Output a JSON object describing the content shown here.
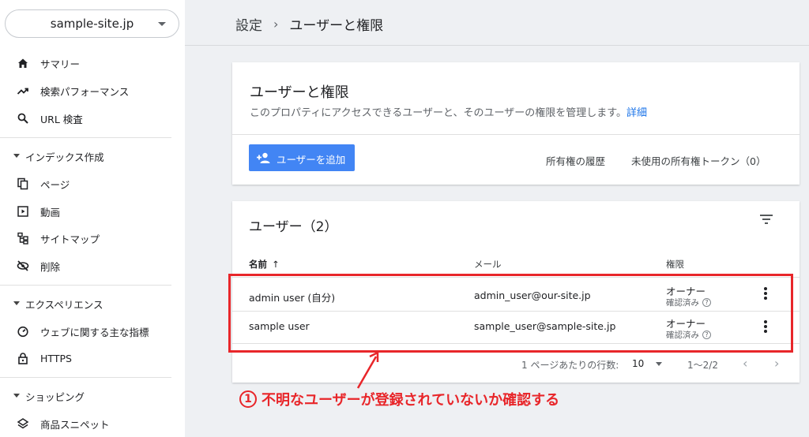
{
  "sidebar": {
    "site": "sample-site.jp",
    "top_items": [
      {
        "label": "サマリー",
        "icon": "home-icon"
      },
      {
        "label": "検索パフォーマンス",
        "icon": "trending-up-icon"
      },
      {
        "label": "URL 検査",
        "icon": "search-icon"
      }
    ],
    "index_section": "インデックス作成",
    "index_items": [
      {
        "label": "ページ",
        "icon": "pages-icon"
      },
      {
        "label": "動画",
        "icon": "video-icon"
      },
      {
        "label": "サイトマップ",
        "icon": "sitemap-icon"
      },
      {
        "label": "削除",
        "icon": "visibility-off-icon"
      }
    ],
    "experience_section": "エクスペリエンス",
    "experience_items": [
      {
        "label": "ウェブに関する主な指標",
        "icon": "gauge-icon"
      },
      {
        "label": "HTTPS",
        "icon": "lock-icon"
      }
    ],
    "shopping_section": "ショッピング",
    "shopping_items": [
      {
        "label": "商品スニペット",
        "icon": "layers-icon"
      }
    ]
  },
  "breadcrumb": {
    "parent": "設定",
    "separator": "›",
    "current": "ユーザーと権限"
  },
  "intro_card": {
    "title": "ユーザーと権限",
    "description": "このプロパティにアクセスできるユーザーと、そのユーザーの権限を管理します。",
    "details_link": "詳細",
    "add_user_button": "ユーザーを追加",
    "ownership_history": "所有権の履歴",
    "unused_tokens": "未使用の所有権トークン（0）"
  },
  "users_card": {
    "title": "ユーザー（2）",
    "columns": {
      "name": "名前",
      "mail": "メール",
      "permission": "権限"
    },
    "rows": [
      {
        "name": "admin user (自分)",
        "email": "admin_user@our-site.jp",
        "role": "オーナー",
        "status": "確認済み"
      },
      {
        "name": "sample user",
        "email": "sample_user@sample-site.jp",
        "role": "オーナー",
        "status": "確認済み"
      }
    ],
    "pagination": {
      "rows_per_page_label": "1 ページあたりの行数:",
      "rows_per_page": "10",
      "range": "1～2/2"
    }
  },
  "annotation": {
    "number": "1",
    "text": "不明なユーザーが登録されていないか確認する",
    "color": "#e8262a"
  },
  "colors": {
    "accent": "#4285f4",
    "link": "#1a73e8",
    "highlight": "#e8262a"
  }
}
